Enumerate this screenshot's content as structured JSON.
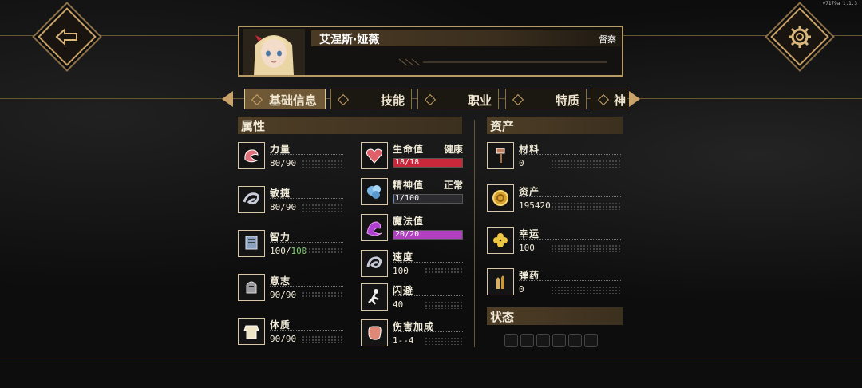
{
  "version": "v7179a_1.1.3",
  "header": {
    "character_name": "艾涅斯·娅薇",
    "action_label": "督察"
  },
  "tabs": [
    {
      "label": "基础信息",
      "active": true
    },
    {
      "label": "技能",
      "active": false
    },
    {
      "label": "职业",
      "active": false
    },
    {
      "label": "特质",
      "active": false
    },
    {
      "label": "神",
      "active": false
    }
  ],
  "attributes": {
    "title": "属性",
    "left": [
      {
        "icon": "strength-arm-icon",
        "label": "力量",
        "value": "80/90"
      },
      {
        "icon": "agility-swirl-icon",
        "label": "敏捷",
        "value": "80/90"
      },
      {
        "icon": "intellect-book-icon",
        "label": "智力",
        "value_main": "100/",
        "value_green": "100"
      },
      {
        "icon": "will-helmet-icon",
        "label": "意志",
        "value": "90/90"
      },
      {
        "icon": "constitution-torso-icon",
        "label": "体质",
        "value": "90/90"
      }
    ],
    "right": [
      {
        "icon": "heart-icon",
        "label": "生命值",
        "status": "健康",
        "bar_text": "18/18",
        "fill": 1.0,
        "bar_color": "#c8283a"
      },
      {
        "icon": "crystal-mind-icon",
        "label": "精神值",
        "status": "正常",
        "bar_text": "1/100",
        "fill": 0.01,
        "bar_color": "#5a8ad0"
      },
      {
        "icon": "magic-tentacle-icon",
        "label": "魔法值",
        "status": "",
        "bar_text": "20/20",
        "fill": 1.0,
        "bar_color": "#b040c0"
      },
      {
        "icon": "speed-swirl-icon",
        "label": "速度",
        "value": "100"
      },
      {
        "icon": "dodge-figure-icon",
        "label": "闪避",
        "value": "40"
      },
      {
        "icon": "damage-fist-icon",
        "label": "伤害加成",
        "value": "1--4"
      }
    ]
  },
  "assets": {
    "title": "资产",
    "items": [
      {
        "icon": "materials-hammer-icon",
        "label": "材料",
        "value": "0"
      },
      {
        "icon": "gold-coin-icon",
        "label": "资产",
        "value": "195420"
      },
      {
        "icon": "luck-clover-icon",
        "label": "幸运",
        "value": "100"
      },
      {
        "icon": "ammo-bullets-icon",
        "label": "弹药",
        "value": "0"
      }
    ]
  },
  "status": {
    "title": "状态"
  }
}
